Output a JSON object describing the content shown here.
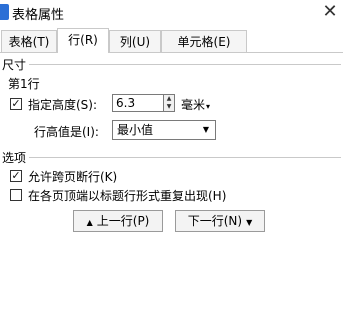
{
  "window": {
    "title": "表格属性",
    "close_glyph": "✕"
  },
  "tabs": [
    {
      "label": "表格(T)",
      "active": false
    },
    {
      "label": "行(R)",
      "active": true
    },
    {
      "label": "列(U)",
      "active": false
    },
    {
      "label": "单元格(E)",
      "active": false
    }
  ],
  "size_group": {
    "label": "尺寸",
    "row_label": "第1行",
    "specify_height": {
      "label": "指定高度(S):",
      "checked": true
    },
    "height_value": "6.3",
    "unit": "毫米",
    "row_height_is": {
      "label": "行高值是(I):",
      "value": "最小值"
    }
  },
  "options_group": {
    "label": "选项",
    "allow_break": {
      "label": "允许跨页断行(K)",
      "checked": true
    },
    "repeat_header": {
      "label": "在各页顶端以标题行形式重复出现(H)",
      "checked": false
    }
  },
  "buttons": {
    "prev_row": "上一行(P)",
    "next_row": "下一行(N)"
  },
  "colors": {
    "app_icon": "#2b6fd6"
  }
}
